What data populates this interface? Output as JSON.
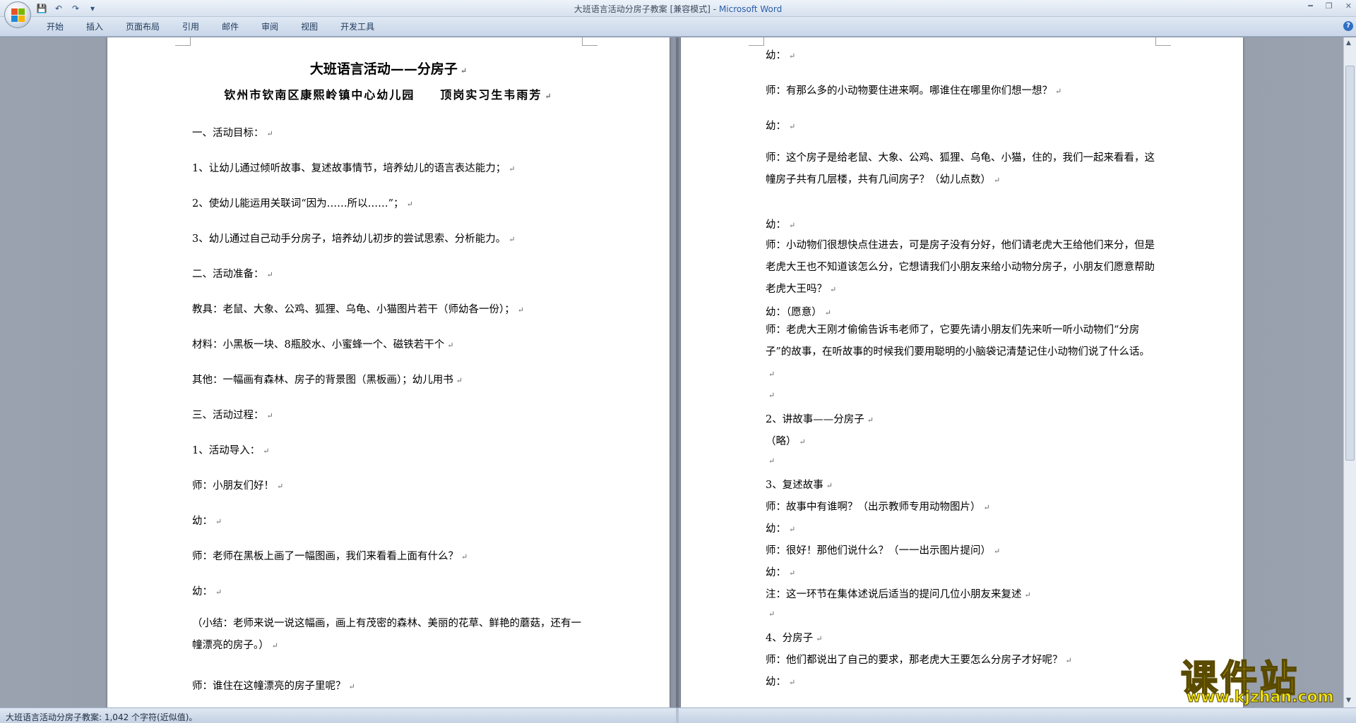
{
  "window": {
    "title_doc": "大班语言活动分房子教案 [兼容模式]",
    "title_sep": " - ",
    "title_app": "Microsoft Word"
  },
  "qat": {
    "save": "💾",
    "undo": "↶",
    "redo": "↷",
    "more": "▾"
  },
  "ribbon": {
    "tabs": [
      "开始",
      "插入",
      "页面布局",
      "引用",
      "邮件",
      "审阅",
      "视图",
      "开发工具"
    ],
    "help": "?"
  },
  "left_page": {
    "title": "大班语言活动——分房子",
    "subtitle": "钦州市钦南区康熙岭镇中心幼儿园　　顶岗实习生韦雨芳",
    "paragraphs": [
      "一、活动目标：",
      "1、让幼儿通过倾听故事、复述故事情节，培养幼儿的语言表达能力；",
      "2、使幼儿能运用关联词“因为……所以……”；",
      "3、幼儿通过自己动手分房子，培养幼儿初步的尝试思索、分析能力。",
      "二、活动准备：",
      "教具：老鼠、大象、公鸡、狐狸、乌龟、小猫图片若干（师幼各一份）；",
      "材料：小黑板一块、8瓶胶水、小蜜蜂一个、磁铁若干个",
      "其他：一幅画有森林、房子的背景图（黑板画）；幼儿用书",
      "三、活动过程：",
      "1、活动导入：",
      "师：小朋友们好！",
      "幼：",
      "师：老师在黑板上画了一幅图画，我们来看看上面有什么？",
      "幼：",
      "（小结：老师来说一说这幅画，画上有茂密的森林、美丽的花草、鲜艳的蘑菇，还有一幢漂亮的房子。）",
      "师：谁住在这幢漂亮的房子里呢？"
    ]
  },
  "right_page": {
    "paragraphs": [
      "幼：",
      "师：有那么多的小动物要住进来啊。哪谁住在哪里你们想一想？",
      "幼：",
      "师：这个房子是给老鼠、大象、公鸡、狐狸、乌龟、小猫，住的，我们一起来看看，这幢房子共有几层楼，共有几间房子？（幼儿点数）",
      "幼：",
      "师：小动物们很想快点住进去，可是房子没有分好，他们请老虎大王给他们来分，但是老虎大王也不知道该怎么分，它想请我们小朋友来给小动物分房子，小朋友们愿意帮助老虎大王吗？",
      "幼：（愿意）",
      "师：老虎大王刚才偷偷告诉韦老师了，它要先请小朋友们先来听一听小动物们“分房子”的故事，在听故事的时候我们要用聪明的小脑袋记清楚记住小动物们说了什么话。",
      "",
      "2、讲故事——分房子",
      "（略）",
      "",
      "3、复述故事",
      "师：故事中有谁啊？（出示教师专用动物图片）",
      "幼：",
      "师：很好！那他们说什么？（一一出示图片提问）",
      "幼：",
      "注：这一环节在集体述说后适当的提问几位小朋友来复述",
      "",
      "4、分房子",
      "师：他们都说出了自己的要求，那老虎大王要怎么分房子才好呢？",
      "幼："
    ]
  },
  "status": {
    "text": "大班语言活动分房子教案: 1,042 个字符(近似值)。"
  },
  "watermark": {
    "main": "课件站",
    "url": "www.kjzhan.com"
  }
}
